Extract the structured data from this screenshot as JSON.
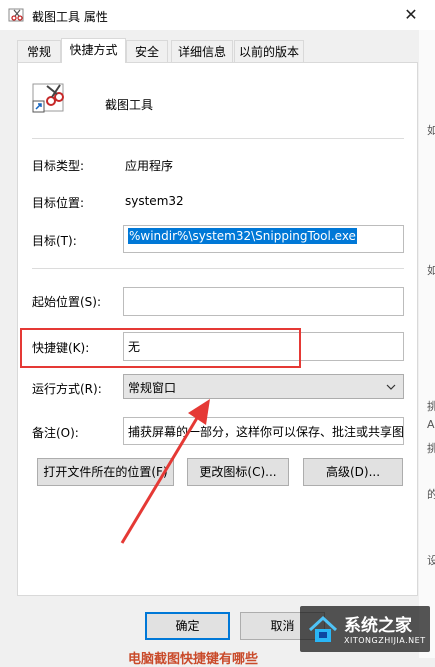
{
  "window": {
    "title": "截图工具 属性",
    "close_glyph": "✕"
  },
  "tabs": [
    {
      "label": "常规",
      "active": false
    },
    {
      "label": "快捷方式",
      "active": true
    },
    {
      "label": "安全",
      "active": false
    },
    {
      "label": "详细信息",
      "active": false
    },
    {
      "label": "以前的版本",
      "active": false
    }
  ],
  "header": {
    "app_name": "截图工具",
    "icon": "scissors-icon"
  },
  "props": {
    "target_type_label": "目标类型:",
    "target_type_value": "应用程序",
    "target_location_label": "目标位置:",
    "target_location_value": "system32",
    "target_label": "目标(T):",
    "target_value": "%windir%\\system32\\SnippingTool.exe",
    "start_in_label": "起始位置(S):",
    "start_in_value": "",
    "shortcut_key_label": "快捷键(K):",
    "shortcut_key_value": "无",
    "run_label": "运行方式(R):",
    "run_value": "常规窗口",
    "comment_label": "备注(O):",
    "comment_value": "捕获屏幕的一部分，这样你可以保存、批注或共享图"
  },
  "buttons": {
    "open_location": "打开文件所在的位置(F)",
    "change_icon": "更改图标(C)...",
    "advanced": "高级(D)...",
    "ok": "确定",
    "cancel": "取消"
  },
  "watermark": {
    "title": "系统之家",
    "sub": "XITONGZHIJIA.NET"
  },
  "background_peek": {
    "bottom_text": "电脑截图快捷键有哪些",
    "side_chars": [
      "如",
      "如",
      "挑",
      "A",
      "挑",
      "的",
      "设"
    ]
  },
  "colors": {
    "highlight_box": "#e53935",
    "arrow": "#e53935",
    "selection": "#0078d7"
  }
}
